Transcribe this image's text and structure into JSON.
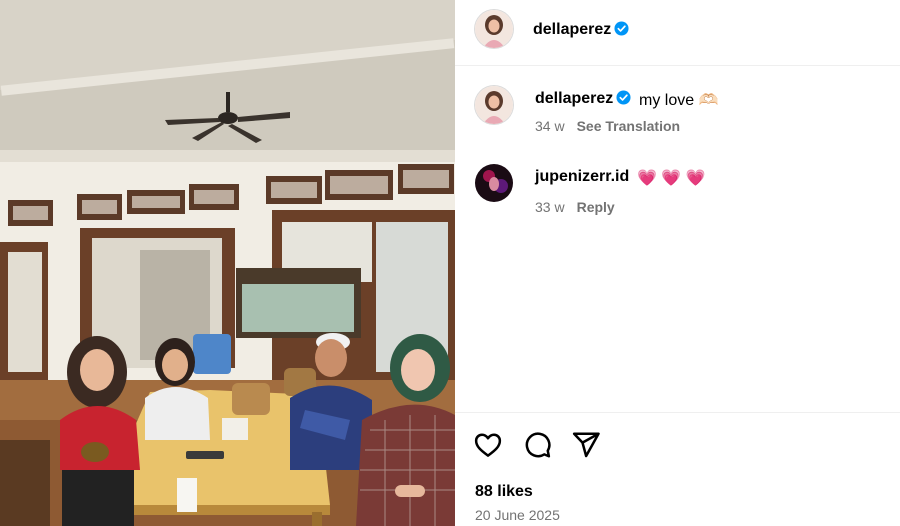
{
  "post": {
    "author": "dellaperez",
    "verified": true
  },
  "comments": [
    {
      "username": "dellaperez",
      "verified": true,
      "text": "my love 🫶🏻",
      "age": "34 w",
      "action": "See Translation"
    },
    {
      "username": "jupenizerr.id",
      "verified": false,
      "text": "💗 💗 💗",
      "age": "33 w",
      "action": "Reply"
    }
  ],
  "footer": {
    "likes": "88 likes",
    "date": "20 June 2025"
  },
  "icons": {
    "like": "heart-icon",
    "comment": "comment-bubble-icon",
    "share": "paper-plane-icon",
    "verified": "verified-badge-icon"
  },
  "colors": {
    "verified_blue": "#0095f6",
    "meta_gray": "#737373",
    "divider": "#efefef"
  }
}
